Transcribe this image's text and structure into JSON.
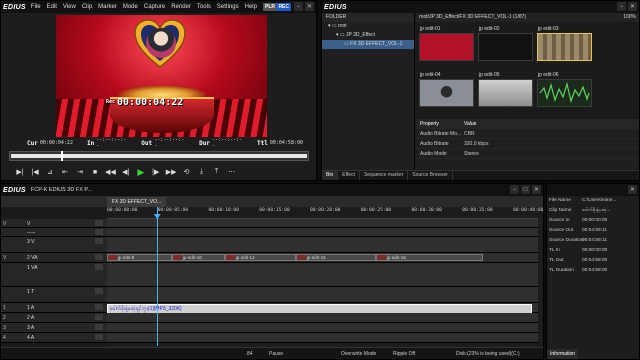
{
  "player": {
    "app_logo": "EDIUS",
    "menu": [
      "File",
      "Edit",
      "View",
      "Clip",
      "Marker",
      "Mode",
      "Capture",
      "Render",
      "Tools",
      "Settings",
      "Help"
    ],
    "mode_badges": [
      "PLR",
      "REC"
    ],
    "overlay_label": "Rec",
    "overlay_timecode": "00:00:04:22",
    "cur_label": "Cur",
    "cur_value": "00:00:04:22",
    "in_label": "In",
    "in_value": "--:--:--:--",
    "out_label": "Out",
    "out_value": "--:--:--:--",
    "dur_label": "Dur",
    "dur_value": "--:--:--:--",
    "ttl_label": "Ttl",
    "ttl_value": "00:04:58:00",
    "scrub_position": 0.17
  },
  "bin": {
    "app_logo": "EDIUS",
    "folder_header": "FOLDER",
    "folders": [
      {
        "label": "root"
      },
      {
        "label": "JP 3D_Effect"
      },
      {
        "label": "FX 3D EFFECT_VOL-1"
      }
    ],
    "path": "root/JP 3D_Effect/FX 3D EFFECT_VOL-1 (1/87)",
    "zoom": "100%",
    "clips": [
      {
        "label": "jp edit-01",
        "color": "#b3112a"
      },
      {
        "label": "jp edit-02",
        "color": "#121212"
      },
      {
        "label": "jp edit-03",
        "color": "#9c8a6a"
      },
      {
        "label": "jp edit-04",
        "color": "#8a8f96"
      },
      {
        "label": "jp edit-05",
        "color": "#b5b5b5"
      },
      {
        "label": "jp edit-06",
        "color": "#1c2a1c"
      }
    ],
    "properties_header": [
      "Property",
      "Value"
    ],
    "properties": [
      {
        "name": "Audio Bitrate Mo...",
        "value": "CBR"
      },
      {
        "name": "Audio Bitrate",
        "value": "320.0 kbps"
      },
      {
        "name": "Audio Mode",
        "value": "Stereo"
      }
    ],
    "tabs": [
      "Bin",
      "Effect",
      "Sequence marker",
      "Source Browser"
    ]
  },
  "timeline": {
    "app_logo": "EDIUS",
    "title": "FCP-K EDIUS 3D FX P...",
    "sequence_tab": "FX 3D EFFECT_VO...",
    "ruler_ticks": [
      "00:00:00:00",
      "00:00:05:00",
      "00:00:10:00",
      "00:00:15:00",
      "00:00:20:00",
      "00:00:25:00",
      "00:00:30:00",
      "00:00:35:00",
      "00:00:40:00"
    ],
    "tracks": [
      {
        "name": "V",
        "patch": "V",
        "height": 9
      },
      {
        "name": "-----",
        "patch": "",
        "height": 9
      },
      {
        "name": "3 V",
        "patch": "",
        "height": 16
      },
      {
        "name": "2 VA",
        "patch": "V",
        "height": 10
      },
      {
        "name": "1 VA",
        "patch": "",
        "height": 24
      },
      {
        "name": "1 T",
        "patch": "",
        "height": 16
      },
      {
        "name": "1 A",
        "patch": "1",
        "height": 10
      },
      {
        "name": "2 A",
        "patch": "2",
        "height": 10
      },
      {
        "name": "3 A",
        "patch": "3",
        "height": 10
      },
      {
        "name": "4 A",
        "patch": "4",
        "height": 10
      }
    ],
    "video_clips": [
      {
        "label": "jp edit-8",
        "start_sec": 0.0,
        "end_sec": 6.4
      },
      {
        "label": "jp edit-10",
        "start_sec": 6.4,
        "end_sec": 11.6
      },
      {
        "label": "jp edit-13",
        "start_sec": 11.6,
        "end_sec": 18.6
      },
      {
        "label": "jp edit-15",
        "start_sec": 18.6,
        "end_sec": 26.5
      },
      {
        "label": "jp edit-16",
        "start_sec": 26.5,
        "end_sec": 37.0
      }
    ],
    "audio_clip": "ခေါက်ခိုးနဲ့မဆုံချင်ဘူး(1)[MP3_320K]",
    "cursor_sec": 4.9,
    "status": {
      "zoom": "84",
      "state": "Pause",
      "mode": "Overwrite Mode",
      "ripple": "Ripple Off",
      "disk": "Disk:(23% is being used)(C:)"
    }
  },
  "info": {
    "rows": [
      {
        "k": "File Name",
        "v": "C:\\Users\\mine..."
      },
      {
        "k": "Clip Name",
        "v": "ခေါက်ခိုးနဲ့မဆုံ..."
      },
      {
        "k": "Source In",
        "v": "00:00:00:00"
      },
      {
        "k": "Source Out",
        "v": "00:04:59:11"
      },
      {
        "k": "Source Duration",
        "v": "00:04:59:11"
      },
      {
        "k": "TL In",
        "v": "00:00:00:00"
      },
      {
        "k": "TL Out",
        "v": "00:04:58:00"
      },
      {
        "k": "TL Duration",
        "v": "00:04:58:00"
      }
    ],
    "tab": "Information"
  }
}
